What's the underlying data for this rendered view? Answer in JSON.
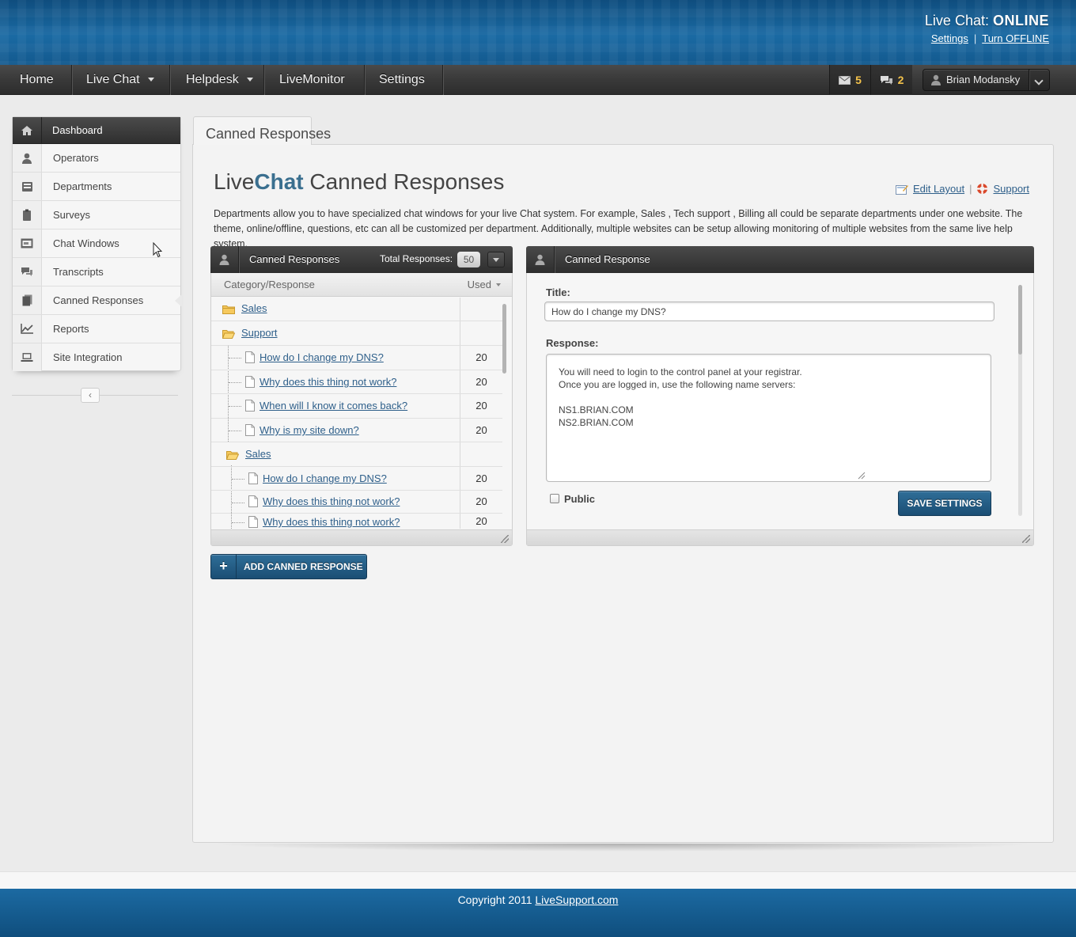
{
  "header": {
    "status_prefix": "Live Chat:",
    "status_value": "ONLINE",
    "settings_link": "Settings",
    "separator": "|",
    "turn_offline_link": "Turn OFFLINE"
  },
  "nav": {
    "items": [
      {
        "label": "Home"
      },
      {
        "label": "Live Chat"
      },
      {
        "label": "Helpdesk"
      },
      {
        "label": "LiveMonitor"
      },
      {
        "label": "Settings"
      }
    ],
    "messages_count": "5",
    "chats_count": "2",
    "user_name": "Brian Modansky"
  },
  "sidebar": {
    "items": [
      {
        "label": "Dashboard",
        "icon": "home-icon"
      },
      {
        "label": "Operators",
        "icon": "user-icon"
      },
      {
        "label": "Departments",
        "icon": "building-icon"
      },
      {
        "label": "Surveys",
        "icon": "clipboard-icon"
      },
      {
        "label": "Chat Windows",
        "icon": "window-icon"
      },
      {
        "label": "Transcripts",
        "icon": "chat-bubbles-icon"
      },
      {
        "label": "Canned Responses",
        "icon": "documents-icon"
      },
      {
        "label": "Reports",
        "icon": "chart-icon"
      },
      {
        "label": "Site Integration",
        "icon": "laptop-icon"
      }
    ],
    "collapse_label": "‹"
  },
  "main": {
    "tab_label": "Canned Responses",
    "heading_prefix": "Live",
    "heading_brand": "Chat",
    "heading_suffix": " Canned Responses",
    "edit_layout_link": "Edit Layout",
    "link_separator": "|",
    "support_link": "Support",
    "intro": "Departments allow you to have specialized chat windows for your live Chat system. For example, Sales , Tech support , Billing all could be separate departments under one website. The theme, online/offline, questions, etc can all be customized per department. Additionally, multiple websites can be setup allowing monitoring of multiple websites from the same live help system."
  },
  "list_widget": {
    "title": "Canned Responses",
    "total_label": "Total Responses:",
    "total_value": "50",
    "col_category": "Category/Response",
    "col_used": "Used",
    "rows": [
      {
        "type": "folder",
        "name": "Sales",
        "used": ""
      },
      {
        "type": "folder",
        "name": "Support",
        "used": ""
      },
      {
        "type": "response",
        "name": "How do I change my DNS?",
        "used": "20"
      },
      {
        "type": "response",
        "name": "Why does this thing not work?",
        "used": "20"
      },
      {
        "type": "response",
        "name": "When will I know it comes back?",
        "used": "20"
      },
      {
        "type": "response",
        "name": "Why is my site down?",
        "used": "20"
      },
      {
        "type": "folder",
        "name": "Sales",
        "used": ""
      },
      {
        "type": "response",
        "name": "How do I change my DNS?",
        "used": "20"
      },
      {
        "type": "response",
        "name": "Why does this thing not work?",
        "used": "20"
      },
      {
        "type": "response",
        "name": "Why does this thing not work?",
        "used": "20"
      }
    ],
    "add_button": "ADD CANNED RESPONSE"
  },
  "detail_widget": {
    "title": "Canned Response",
    "title_label": "Title:",
    "title_value": "How do I change my DNS?",
    "response_label": "Response:",
    "response_value": "You will need to login to the control panel at your registrar.\nOnce you are logged in, use the following name servers:\n\nNS1.BRIAN.COM\nNS2.BRIAN.COM",
    "public_label": "Public",
    "public_checked": false,
    "save_button": "SAVE SETTINGS"
  },
  "footer": {
    "copyright": "Copyright 2011 ",
    "site_link": "LiveSupport.com"
  },
  "colors": {
    "header_blue": "#1a6aa3",
    "nav_dark": "#393939",
    "link_blue": "#2e5f8a",
    "badge_yellow": "#f5c34b",
    "button_blue": "#1b4e74"
  }
}
